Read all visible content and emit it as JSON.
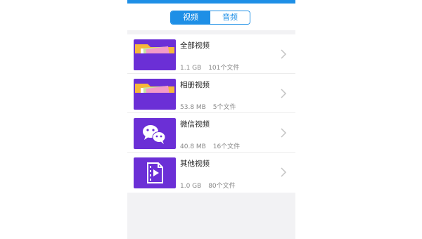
{
  "tabs": [
    {
      "label": "视频",
      "active": true
    },
    {
      "label": "音频",
      "active": false
    }
  ],
  "items": [
    {
      "title": "全部视频",
      "size": "1.1 GB",
      "count": "101个文件",
      "icon": "folder-icon"
    },
    {
      "title": "相册视频",
      "size": "53.8 MB",
      "count": "5个文件",
      "icon": "folder-icon"
    },
    {
      "title": "微信视频",
      "size": "40.8 MB",
      "count": "16个文件",
      "icon": "wechat-icon"
    },
    {
      "title": "其他视频",
      "size": "1.0 GB",
      "count": "80个文件",
      "icon": "video-file-icon"
    }
  ],
  "colors": {
    "accent": "#1e8fe6",
    "purple": "#6b2fd6",
    "folder_yellow": "#f6b83a"
  }
}
